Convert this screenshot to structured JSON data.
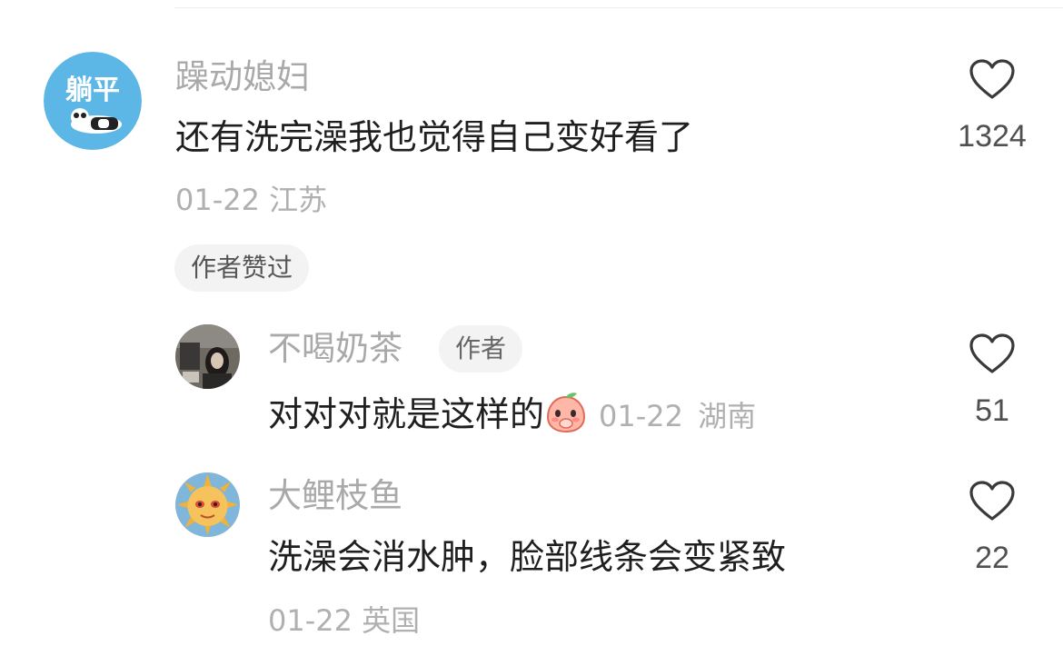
{
  "comments": [
    {
      "username": "躁动媳妇",
      "avatar_text": "躺平",
      "text": "还有洗完澡我也觉得自己变好看了",
      "date": "01-22",
      "location": "江苏",
      "author_liked_label": "作者赞过",
      "likes": "1324",
      "replies": [
        {
          "username": "不喝奶茶",
          "author_badge": "作者",
          "text": "对对对就是这样的",
          "emoji": "peach-cover-mouth-emoji",
          "date": "01-22",
          "location": "湖南",
          "likes": "51"
        },
        {
          "username": "大鲤枝鱼",
          "text": "洗澡会消水肿，脸部线条会变紧致",
          "date": "01-22",
          "location": "英国",
          "likes": "22"
        }
      ]
    }
  ],
  "icons": {
    "like": "heart-outline-icon"
  },
  "colors": {
    "username": "#a9a9a9",
    "meta": "#b0b0b0",
    "text": "#1f1f1f",
    "pill_bg": "#f3f3f3"
  }
}
